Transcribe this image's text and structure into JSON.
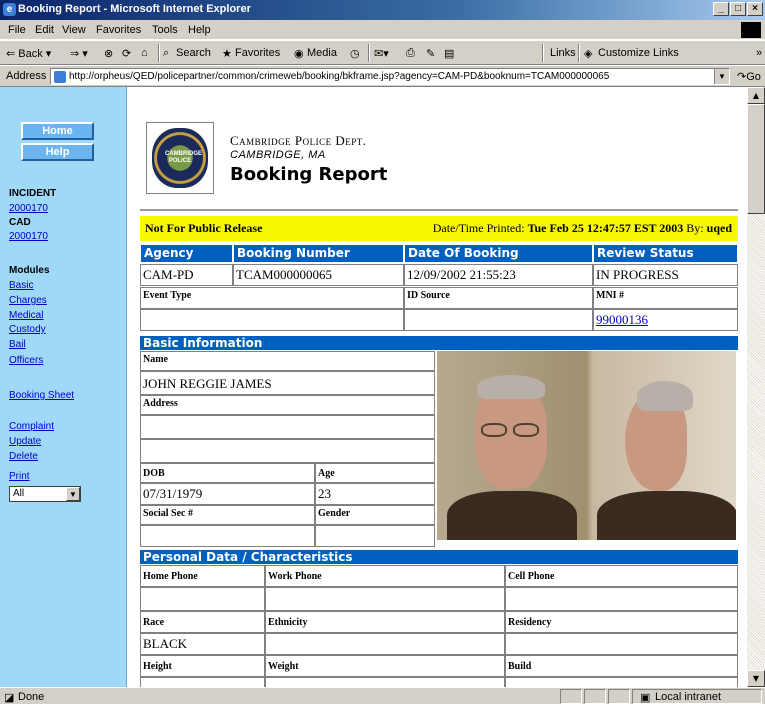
{
  "window": {
    "title": "Booking Report - Microsoft Internet Explorer",
    "min": "_",
    "max": "□",
    "close": "×"
  },
  "menu": [
    "File",
    "Edit",
    "View",
    "Favorites",
    "Tools",
    "Help"
  ],
  "toolbar": {
    "back": "⇐ Back ▾",
    "forward": "⇒ ▾",
    "search": "Search",
    "favorites": "Favorites",
    "media": "Media",
    "links": "Links",
    "customize": "Customize Links",
    "chev": "»"
  },
  "address": {
    "label": "Address",
    "url": "http://orpheus/QED/policepartner/common/crimeweb/booking/bkframe.jsp?agency=CAM-PD&booknum=TCAM000000065",
    "go": "Go"
  },
  "sidebar": {
    "home": "Home",
    "help": "Help",
    "incident_h": "INCIDENT",
    "incident": "2000170",
    "cad_h": "CAD",
    "cad": "2000170",
    "modules_h": "Modules",
    "modules": [
      "Basic",
      "Charges",
      "Medical",
      "Custody",
      "Bail",
      "Officers"
    ],
    "booking_sheet": "Booking Sheet",
    "complaint": "Complaint",
    "update": "Update",
    "delete": "Delete",
    "print": "Print",
    "print_sel": "All"
  },
  "header": {
    "dept": "Cambridge Police Dept.",
    "city": "CAMBRIDGE, MA",
    "title": "Booking Report",
    "seal": "CAMBRIDGE POLICE"
  },
  "banner": {
    "nfp": "Not For Public Release",
    "printed_label": "Date/Time Printed:",
    "printed": "Tue Feb 25 12:47:57 EST 2003",
    "by_label": "By:",
    "by": "uqed"
  },
  "booking": {
    "h_agency": "Agency",
    "h_number": "Booking Number",
    "h_date": "Date Of Booking",
    "h_review": "Review Status",
    "agency": "CAM-PD",
    "number": "TCAM000000065",
    "date": "12/09/2002 21:55:23",
    "review": "IN PROGRESS",
    "l_event": "Event Type",
    "l_idsource": "ID Source",
    "l_mni": "MNI #",
    "mni": "99000136"
  },
  "basic": {
    "bar": "Basic Information",
    "l_name": "Name",
    "name": "JOHN REGGIE JAMES",
    "l_address": "Address",
    "l_dob": "DOB",
    "dob": "07/31/1979",
    "l_age": "Age",
    "age": "23",
    "l_ssn": "Social Sec #",
    "l_gender": "Gender"
  },
  "personal": {
    "bar": "Personal Data / Characteristics",
    "l_home": "Home Phone",
    "l_work": "Work Phone",
    "l_cell": "Cell Phone",
    "l_race": "Race",
    "race": "BLACK",
    "l_ethnicity": "Ethnicity",
    "l_residency": "Residency",
    "l_height": "Height",
    "l_weight": "Weight",
    "l_build": "Build"
  },
  "status": {
    "done": "Done",
    "zone": "Local intranet"
  },
  "colors": {
    "sidebar": "#a0d8f8",
    "header_blue": "#0060c0",
    "banner": "#f8f800"
  }
}
